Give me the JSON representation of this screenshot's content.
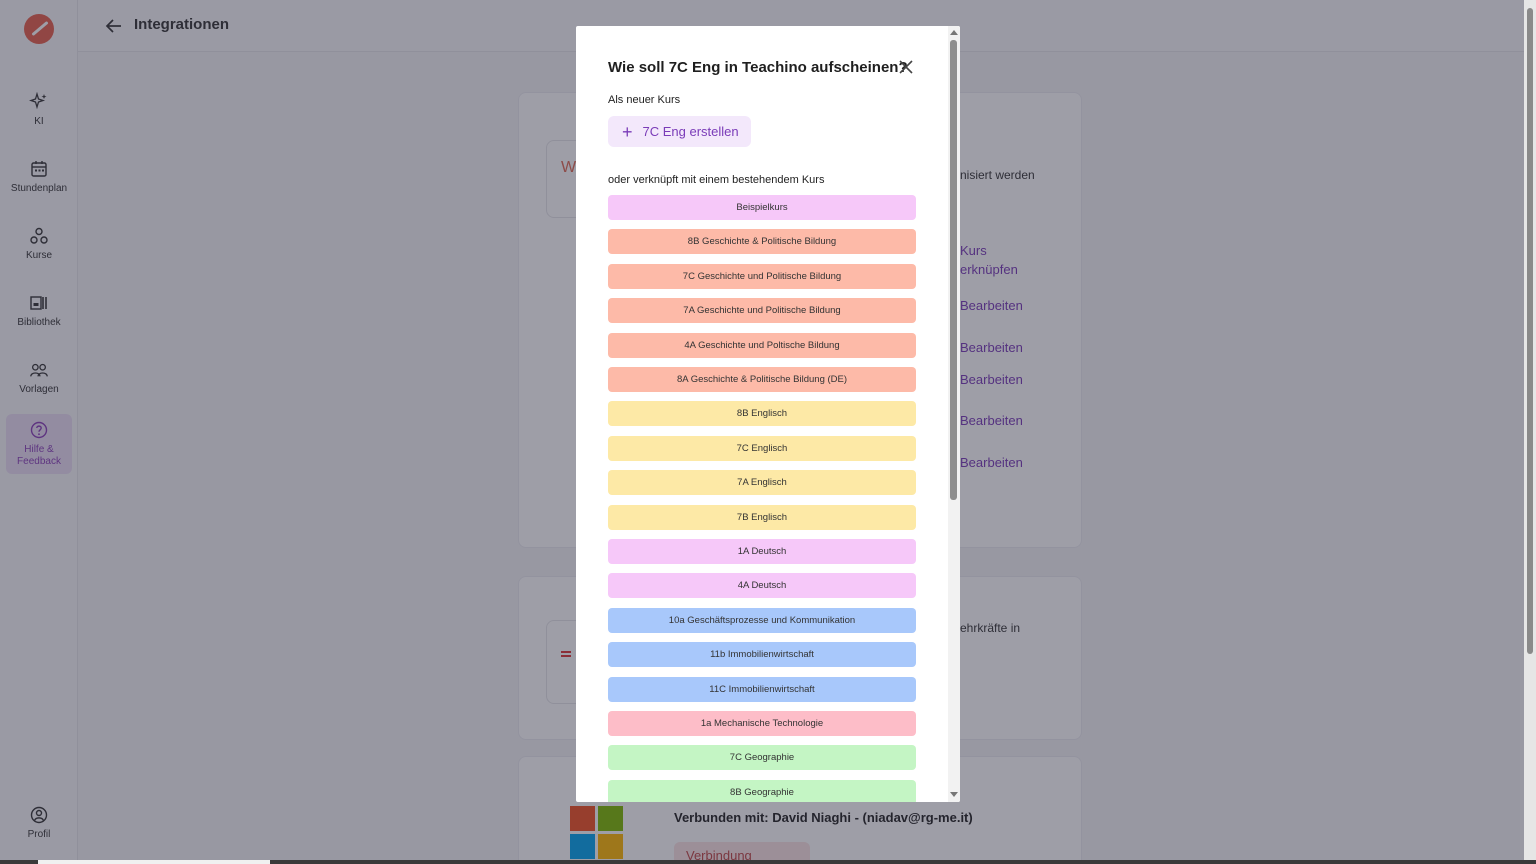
{
  "header": {
    "title": "Integrationen"
  },
  "sidebar": {
    "items": [
      {
        "label": "KI",
        "icon": "sparkles-icon"
      },
      {
        "label": "Stundenplan",
        "icon": "calendar-icon"
      },
      {
        "label": "Kurse",
        "icon": "courses-icon"
      },
      {
        "label": "Bibliothek",
        "icon": "library-icon"
      },
      {
        "label": "Vorlagen",
        "icon": "templates-icon"
      },
      {
        "label": "Hilfe & Feedback",
        "icon": "help-icon"
      },
      {
        "label": "Profil",
        "icon": "profile-icon"
      }
    ]
  },
  "background": {
    "fragment_w": "W",
    "text_synced": "nisiert werden",
    "link_kurs": "Kurs",
    "link_verknuepfen": "erknüpfen",
    "edit_label": "Bearbeiten",
    "text_lehrkraefte": "ehrkräfte in",
    "connected_text": "Verbunden mit: David Niaghi - (niadav@rg-me.it)",
    "disconnect_label": "Verbindung trennen"
  },
  "modal": {
    "title": "Wie soll 7C Eng in Teachino aufscheinen?",
    "new_course_label": "Als neuer Kurs",
    "create_button": "7C Eng erstellen",
    "link_existing_label": "oder verknüpft mit einem bestehendem Kurs",
    "courses": [
      {
        "name": "Beispielkurs",
        "color": "#f6c8f9"
      },
      {
        "name": "8B Geschichte & Politische Bildung",
        "color": "#fdbaa8"
      },
      {
        "name": "7C Geschichte und Politische Bildung",
        "color": "#fdbaa8"
      },
      {
        "name": "7A Geschichte und Politische Bildung",
        "color": "#fdbaa8"
      },
      {
        "name": "4A Geschichte und Poltische Bildung",
        "color": "#fdbaa8"
      },
      {
        "name": "8A Geschichte & Politische Bildung (DE)",
        "color": "#fdbaa8"
      },
      {
        "name": "8B Englisch",
        "color": "#fde9a6"
      },
      {
        "name": "7C Englisch",
        "color": "#fde9a6"
      },
      {
        "name": "7A Englisch",
        "color": "#fde9a6"
      },
      {
        "name": "7B Englisch",
        "color": "#fde9a6"
      },
      {
        "name": "1A Deutsch",
        "color": "#f6c8f9"
      },
      {
        "name": "4A Deutsch",
        "color": "#f6c8f9"
      },
      {
        "name": "10a Geschäftsprozesse und Kommunikation",
        "color": "#a8c8fb"
      },
      {
        "name": "11b Immobilienwirtschaft",
        "color": "#a8c8fb"
      },
      {
        "name": "11C Immobilienwirtschaft",
        "color": "#a8c8fb"
      },
      {
        "name": "1a Mechanische Technologie",
        "color": "#fdbdc8"
      },
      {
        "name": "7C Geographie",
        "color": "#c4f5c4"
      },
      {
        "name": "8B Geographie",
        "color": "#c4f5c4"
      }
    ]
  }
}
